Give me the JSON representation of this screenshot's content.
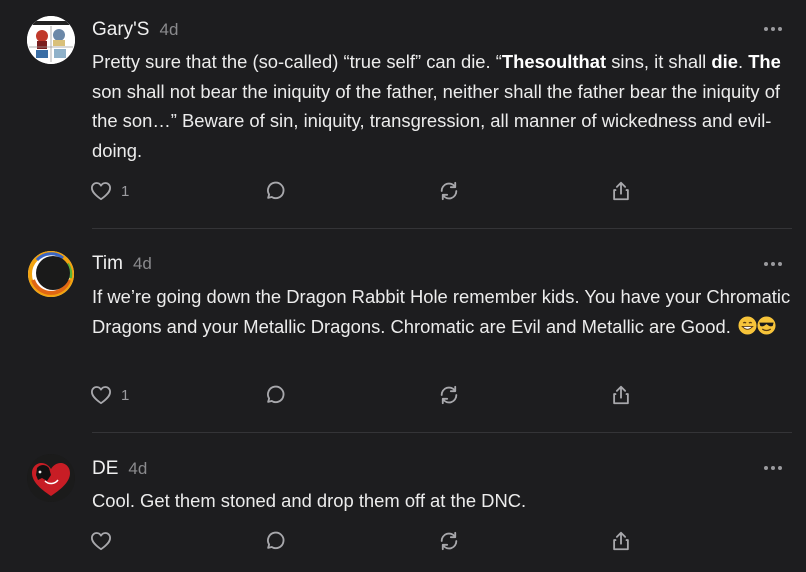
{
  "comments": [
    {
      "author": "Gary'S",
      "age": "4d",
      "text_segments": [
        "Pretty sure that the (so-called) “true self” can die. “",
        "Thesoulthat",
        " sins, it shall ",
        "die",
        ". ",
        "The",
        " son shall not bear the iniquity of the father, neither shall the father bear the iniquity of the son…” Beware of sin, iniquity, transgression, all manner of wickedness and evil-doing."
      ],
      "like_count": "1",
      "avatar_icon": "collage-avatar"
    },
    {
      "author": "Tim",
      "age": "4d",
      "text": "If we’re going down the Dragon Rabbit Hole remember kids. You have your Chromatic Dragons and your Metallic Dragons. Chromatic are Evil and Metallic are Good.",
      "emojis": [
        "grinning-face-emoji",
        "sunglasses-face-emoji"
      ],
      "like_count": "1",
      "avatar_icon": "rainbow-ring-avatar"
    },
    {
      "author": "DE",
      "age": "4d",
      "text": "Cool. Get them stoned and drop them off at the DNC.",
      "like_count": "",
      "avatar_icon": "dog-heart-avatar"
    }
  ],
  "icons": {
    "like": "heart-icon",
    "reply": "speech-bubble-icon",
    "restack": "restack-icon",
    "share": "share-icon",
    "more": "ellipsis-icon"
  },
  "colors": {
    "background": "#1d1d1f",
    "text": "#ececec",
    "muted": "#8a8a8d",
    "icon": "#a8a8ac",
    "divider": "#343437"
  }
}
